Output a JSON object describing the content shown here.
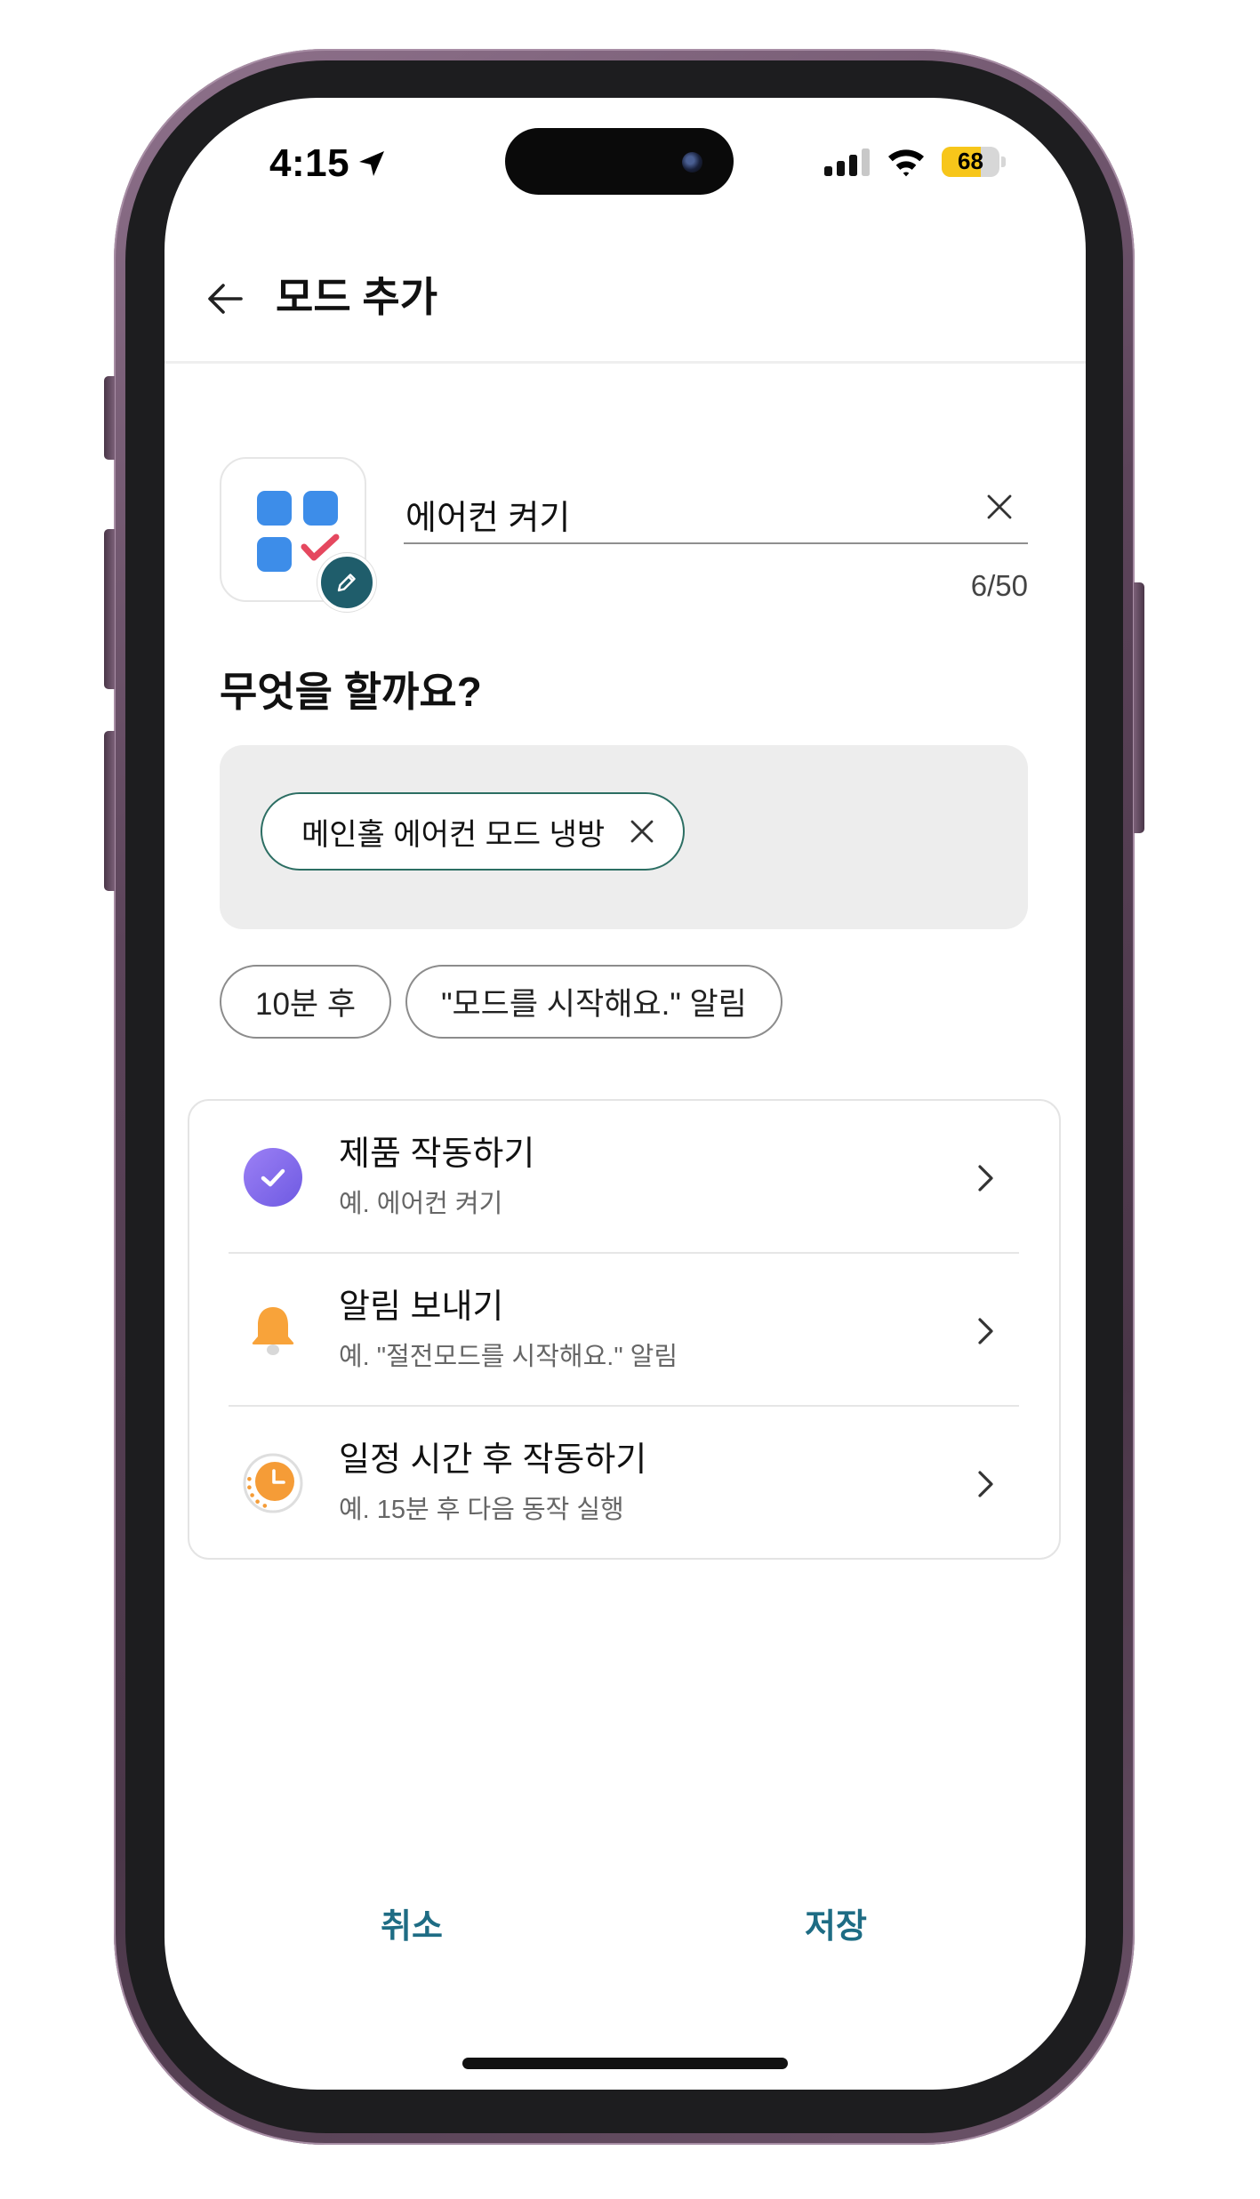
{
  "status_bar": {
    "time": "4:15",
    "signal": {
      "bars": 3,
      "max": 4
    },
    "battery": {
      "label": "68",
      "level": 0.68
    }
  },
  "header": {
    "back_icon": "arrow-left-icon",
    "title": "모드 추가"
  },
  "mode": {
    "icon": "grid-check-icon",
    "name": "에어컨 켜기",
    "char_count": "6/50"
  },
  "actions": {
    "heading": "무엇을 할까요?",
    "selected": [
      {
        "label": "메인홀 에어컨 모드 냉방"
      }
    ],
    "follow_ups": [
      {
        "label": "10분 후"
      },
      {
        "label": "\"모드를 시작해요.\" 알림"
      }
    ]
  },
  "action_types": [
    {
      "icon": "check-circle-icon",
      "title": "제품 작동하기",
      "subtitle": "예. 에어컨 켜기"
    },
    {
      "icon": "bell-icon",
      "title": "알림 보내기",
      "subtitle": "예. \"절전모드를 시작해요.\" 알림"
    },
    {
      "icon": "timer-icon",
      "title": "일정 시간 후 작동하기",
      "subtitle": "예. 15분 후 다음 동작 실행"
    }
  ],
  "footer": {
    "cancel_label": "취소",
    "save_label": "저장"
  },
  "colors": {
    "accent": "#1e6c84",
    "chip_border": "#2c6e63",
    "edit_badge": "#1f5d6b",
    "battery_fill": "#f7c61a",
    "phone_frame": "#5c445a"
  }
}
